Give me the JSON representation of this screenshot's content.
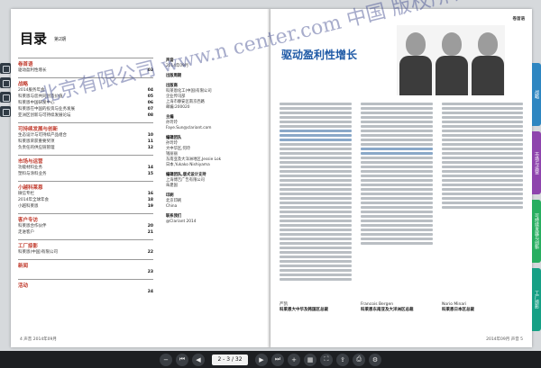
{
  "left_page": {
    "title": "目录",
    "subtitle": "第2期",
    "sections": [
      {
        "label": "卷首语",
        "items": [
          {
            "text": "驱动盈利性增长",
            "num": "03"
          }
        ]
      },
      {
        "label": "战略",
        "items": [
          {
            "text": "2014服务年会",
            "num": "04"
          },
          {
            "text": "科莱恩与您共同创造价值",
            "num": "05"
          },
          {
            "text": "科莱恩中国研发中心",
            "num": "06"
          },
          {
            "text": "科莱恩在中国的投资与业务发展",
            "num": "07"
          },
          {
            "text": "亚洲区创新与可持续发展论坛",
            "num": "08"
          }
        ]
      },
      {
        "label": "可持续发展与创新",
        "items": [
          {
            "text": "生态设计与可持续产品组合",
            "num": "10"
          },
          {
            "text": "科莱恩荣获重要奖项",
            "num": "11"
          },
          {
            "text": "负责任的供应链管理",
            "num": "12"
          }
        ]
      },
      {
        "label": "市场与运营",
        "items": [
          {
            "text": "功能材料业务",
            "num": "14"
          },
          {
            "text": "塑料与涂料业务",
            "num": "15"
          }
        ]
      },
      {
        "label": "小越科莱恩",
        "items": [
          {
            "text": "微信专栏",
            "num": "16"
          },
          {
            "text": "2014年全球年会",
            "num": "18"
          },
          {
            "text": "小越科莱恩",
            "num": "19"
          }
        ]
      },
      {
        "label": "客户专访",
        "items": [
          {
            "text": "科莱恩合作伙伴",
            "num": "20"
          },
          {
            "text": "走进客户",
            "num": "21"
          }
        ]
      },
      {
        "label": "工厂掠影",
        "items": [
          {
            "text": "科莱恩(中国)有限公司",
            "num": "22"
          }
        ]
      },
      {
        "label": "新闻",
        "items": [
          {
            "text": "",
            "num": "23"
          }
        ]
      },
      {
        "label": "活动",
        "items": [
          {
            "text": "",
            "num": "24"
          }
        ]
      }
    ],
    "masthead": [
      {
        "h": "声音",
        "lines": [
          "2014年09月"
        ]
      },
      {
        "h": "出版周期",
        "lines": []
      },
      {
        "h": "出版商",
        "lines": [
          "科莱恩化工(中国)有限公司",
          "企业传讯部",
          "上海市静安区南京西路",
          "邮编:200020"
        ]
      },
      {
        "h": "主编",
        "lines": [
          "孙玲玲",
          "Faye.Sun@clariant.com"
        ]
      },
      {
        "h": "编辑团队",
        "lines": [
          "孙玲玲",
          "大中华区,何玲",
          "钱丽丽",
          "东南亚及大洋洲地区,Jessie Lok",
          "日本,Yukako Nishiyama"
        ]
      },
      {
        "h": "编辑团队,版式设计支持",
        "lines": [
          "上海博吉广告有限公司",
          "朱建国"
        ]
      },
      {
        "h": "印刷",
        "lines": [
          "北京印刷",
          "China"
        ]
      },
      {
        "h": "联系我们",
        "lines": [
          "@Clariant 2014"
        ]
      }
    ],
    "footer": "4 声音 2014年09月"
  },
  "right_page": {
    "header": "卷首语",
    "title": "驱动盈利性增长",
    "signatures": [
      {
        "role": "严凯",
        "name": "科莱恩大中华及韩国区总裁"
      },
      {
        "role": "Francois Bergen",
        "name": "科莱恩东南亚及大洋洲区总裁"
      },
      {
        "role": "Norio Minari",
        "name": "科莱恩日本区总裁"
      }
    ],
    "footer": "2014年09月 声音 5"
  },
  "index_tabs": [
    {
      "label": "战略",
      "color": "#2e86c1"
    },
    {
      "label": "市场与运营",
      "color": "#8e44ad"
    },
    {
      "label": "可持续发展与创新",
      "color": "#27ae60"
    },
    {
      "label": "工厂掠影",
      "color": "#16a085"
    }
  ],
  "toolbar": {
    "page_indicator": "2 - 3 / 32",
    "buttons": [
      "zoom-out",
      "first-page",
      "prev-page",
      "next-page",
      "last-page",
      "zoom-in",
      "thumbnails",
      "fullscreen",
      "share",
      "print",
      "settings"
    ]
  },
  "watermark": "北京有限公司 www.n center.com 中国 版权所有"
}
